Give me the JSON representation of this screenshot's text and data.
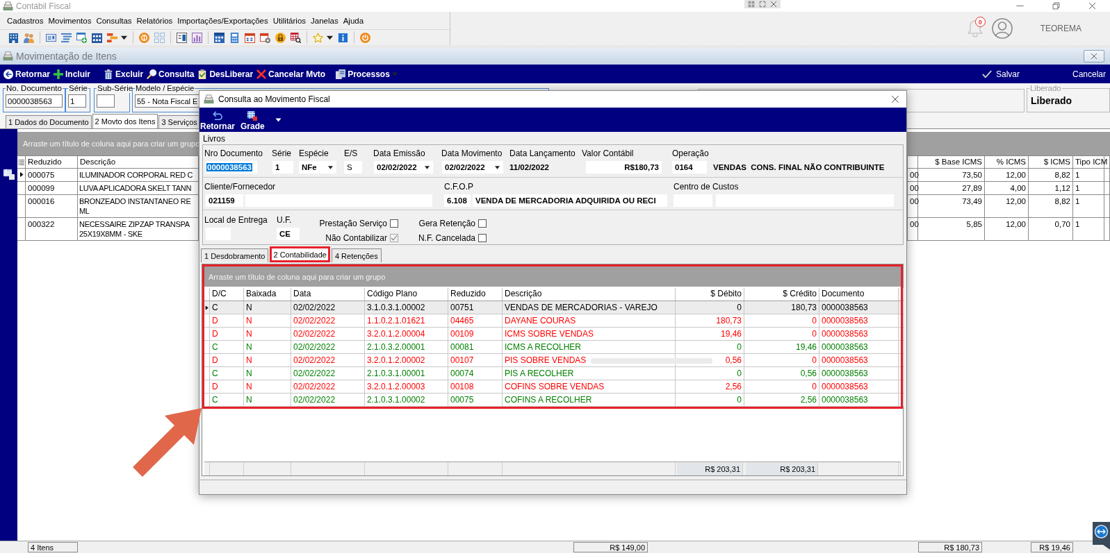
{
  "app": {
    "title": "Contábil Fiscal",
    "menu": [
      "Cadastros",
      "Movimentos",
      "Consultas",
      "Relatórios",
      "Importações/Exportações",
      "Utilitários",
      "Janelas",
      "Ajuda"
    ],
    "notifications": "0",
    "user": "TEOREMA"
  },
  "window": {
    "title": "Movimentação de Itens",
    "toolbar": [
      {
        "label": "Retornar",
        "kind": "button"
      },
      {
        "label": "Incluir",
        "kind": "button"
      },
      {
        "label": "Excluir",
        "kind": "button"
      },
      {
        "label": "Consulta",
        "kind": "button"
      },
      {
        "label": "DesLiberar",
        "kind": "button"
      },
      {
        "label": "Cancelar Mvto",
        "kind": "button"
      },
      {
        "label": "Processos",
        "kind": "menu"
      }
    ],
    "actions": [
      {
        "label": "Salvar",
        "kind": "confirm"
      },
      {
        "label": "Cancelar",
        "kind": "plain"
      }
    ],
    "fields": [
      {
        "label": "No. Documento",
        "value": "0000038563"
      },
      {
        "label": "Série",
        "value": "1"
      },
      {
        "label": "Sub-Série"
      },
      {
        "label": "Modelo / Espécie",
        "value": "55 - Nota Fiscal E"
      }
    ],
    "release": {
      "label": "Liberado",
      "value": "Liberado"
    },
    "tabs": [
      {
        "label": "1 Dados do Documento",
        "selected": false
      },
      {
        "label": "2 Movto dos Itens",
        "selected": true
      },
      {
        "label": "3 Serviços",
        "selected": false
      }
    ],
    "grid": {
      "group_hint": "Arraste um título de coluna aqui para criar um grupo",
      "columns": {
        "reduzido": "Reduzido",
        "descricao": "Descrição",
        "base_icms": "$ Base ICMS",
        "pct_icms": "% ICMS",
        "icms": "$ ICMS",
        "tipo_icm": "Tipo ICM"
      },
      "rows": [
        {
          "selected": true,
          "reduzido": "000075",
          "descricao": "ILUMINADOR CORPORAL RED C",
          "column_3": "00",
          "base_icms": "73,50",
          "pct_icms": "12,00",
          "icms": "8,82",
          "tipo_icm": "1"
        },
        {
          "selected": false,
          "reduzido": "000099",
          "descricao": "LUVA APLICADORA SKELT TANN",
          "column_3": "00",
          "base_icms": "27,89",
          "pct_icms": "4,00",
          "icms": "1,12",
          "tipo_icm": "1"
        },
        {
          "selected": false,
          "reduzido": "000016",
          "descricao": "BRONZEADO INSTANTANEO RE\nML",
          "column_3": "00",
          "base_icms": "73,49",
          "pct_icms": "12,00",
          "icms": "8,82",
          "tipo_icm": "1"
        },
        {
          "selected": false,
          "reduzido": "000322",
          "descricao": "NECESSAIRE ZIPZAP TRANSPA\n25X19X8MM - SKE",
          "column_3": "00",
          "base_icms": "5,85",
          "pct_icms": "12,00",
          "icms": "0,70",
          "tipo_icm": "1"
        }
      ]
    },
    "status_bar": [
      "4 Itens",
      "R$ 149,00",
      "R$ 180,73",
      "R$ 19,46"
    ]
  },
  "dialog": {
    "title": "Consulta ao Movimento Fiscal",
    "toolbar": [
      {
        "label": "Retornar",
        "kind": "button"
      },
      {
        "label": "Grade",
        "kind": "split"
      }
    ],
    "form": {
      "legend": "Livros",
      "row_1": [
        {
          "kind": "text",
          "label": "Nro Documento",
          "value": "0000038563",
          "focused": true
        },
        {
          "kind": "text",
          "label": "Série",
          "value": "1",
          "focused": false
        },
        {
          "kind": "dropdown",
          "label": "Espécie",
          "value": "NFe",
          "focused": false
        },
        {
          "kind": "readonly",
          "label": "E/S",
          "value": "S",
          "focused": false
        },
        {
          "kind": "dropdown",
          "label": "Data Emissão",
          "value": "02/02/2022",
          "focused": false
        },
        {
          "kind": "dropdown",
          "label": "Data Movimento",
          "value": "02/02/2022",
          "focused": false
        },
        {
          "kind": "plain",
          "label": "Data Lançamento",
          "value": "11/02/2022",
          "focused": false
        },
        {
          "kind": "amount",
          "label": "Valor Contábil",
          "value": "R$180,73",
          "focused": false
        },
        {
          "kind": "text",
          "label": "Operação",
          "value": "0164",
          "focused": false
        },
        {
          "kind": "plain",
          "value": "VENDAS  CONS. FINAL NÃO CONTRIBUINTE",
          "focused": false
        }
      ],
      "row_2": [
        {
          "kind": "pair",
          "label": "Cliente/Fornecedor",
          "code": "021159"
        },
        {
          "kind": "pair",
          "label": "C.F.O.P",
          "code": "6.108",
          "name": "VENDA DE MERCADORIA ADQUIRIDA OU RECI"
        },
        {
          "kind": "pair",
          "label": "Centro de Custos"
        }
      ],
      "row_3": {
        "fields": [
          {
            "kind": "text",
            "label": "Local de Entrega"
          },
          {
            "kind": "text",
            "label": "U.F.",
            "value": "CE"
          }
        ],
        "checkboxes": [
          {
            "label": "Prestação Serviço",
            "checked": false,
            "disabled": false
          },
          {
            "label": "Gera Retenção",
            "checked": false,
            "disabled": false
          },
          {
            "label": "Não Contabilizar",
            "checked": true,
            "disabled": true
          },
          {
            "label": "N.F. Cancelada",
            "checked": false,
            "disabled": false
          }
        ]
      }
    },
    "tabs": [
      {
        "label": "1 Desdobramento",
        "selected": false,
        "highlighted": false
      },
      {
        "label": "2 Contabilidade",
        "selected": true,
        "highlighted": true
      },
      {
        "label": "4 Retenções",
        "selected": false,
        "highlighted": false
      }
    ],
    "entries": {
      "highlighted": true,
      "group_hint": "Arraste um título de coluna aqui para criar um grupo",
      "columns": [
        "D/C",
        "Baixada",
        "Data",
        "Código Plano",
        "Reduzido",
        "Descrição",
        "$ Débito",
        "$ Crédito",
        "Documento"
      ],
      "rows": [
        {
          "selected": true,
          "redacted": false,
          "color": "#000000",
          "cells": [
            "C",
            "N",
            "02/02/2022",
            "3.1.0.3.1.00002",
            "00751",
            "VENDAS DE MERCADORIAS - VAREJO",
            "0",
            "180,73",
            "0000038563"
          ]
        },
        {
          "selected": false,
          "redacted": false,
          "color": "#ff0000",
          "cells": [
            "D",
            "N",
            "02/02/2022",
            "1.1.0.2.1.01621",
            "04465",
            "DAYANE COURAS",
            "180,73",
            "0",
            "0000038563"
          ]
        },
        {
          "selected": false,
          "redacted": false,
          "color": "#ff0000",
          "cells": [
            "D",
            "N",
            "02/02/2022",
            "3.2.0.1.2.00004",
            "00109",
            "ICMS SOBRE VENDAS",
            "19,46",
            "0",
            "0000038563"
          ]
        },
        {
          "selected": false,
          "redacted": false,
          "color": "#008000",
          "cells": [
            "C",
            "N",
            "02/02/2022",
            "2.1.0.3.2.00001",
            "00081",
            "ICMS A RECOLHER",
            "0",
            "19,46",
            "0000038563"
          ]
        },
        {
          "selected": false,
          "redacted": true,
          "color": "#ff0000",
          "cells": [
            "D",
            "N",
            "02/02/2022",
            "3.2.0.1.2.00002",
            "00107",
            "PIS SOBRE VENDAS",
            "0,56",
            "0",
            "0000038563"
          ]
        },
        {
          "selected": false,
          "redacted": false,
          "color": "#008000",
          "cells": [
            "C",
            "N",
            "02/02/2022",
            "2.1.0.3.1.00001",
            "00074",
            "PIS A RECOLHER",
            "0",
            "0,56",
            "0000038563"
          ]
        },
        {
          "selected": false,
          "redacted": false,
          "color": "#ff0000",
          "cells": [
            "D",
            "N",
            "02/02/2022",
            "3.2.0.1.2.00003",
            "00108",
            "COFINS SOBRE VENDAS",
            "2,56",
            "0",
            "0000038563"
          ]
        },
        {
          "selected": false,
          "redacted": false,
          "color": "#008000",
          "cells": [
            "C",
            "N",
            "02/02/2022",
            "2.1.0.3.1.00002",
            "00075",
            "COFINS A RECOLHER",
            "0",
            "2,56",
            "0000038563"
          ]
        }
      ],
      "totals": {
        "debit": "R$ 203,31",
        "credit": "R$ 203,31"
      }
    }
  },
  "annotations": [
    {
      "kind": "arrow"
    }
  ]
}
